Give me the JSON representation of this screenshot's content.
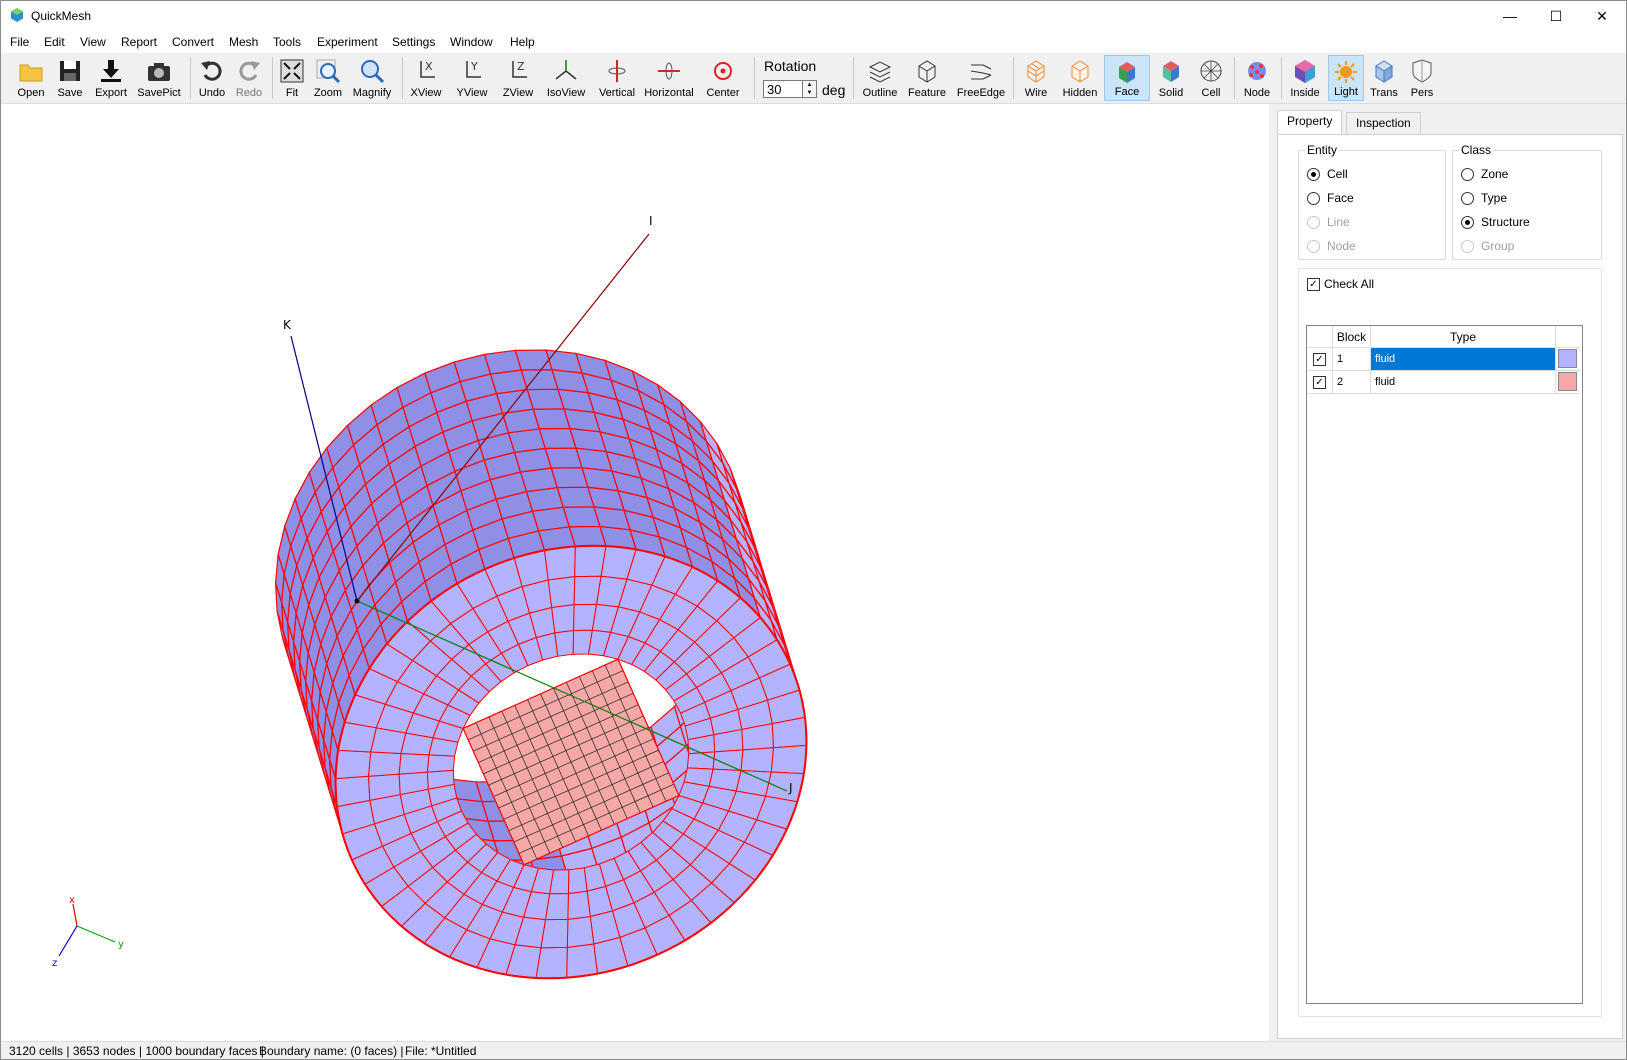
{
  "window": {
    "title": "QuickMesh",
    "minimize": "—",
    "maximize": "☐",
    "close": "✕"
  },
  "menu": [
    "File",
    "Edit",
    "View",
    "Report",
    "Convert",
    "Mesh",
    "Tools",
    "Experiment",
    "Settings",
    "Window",
    "Help"
  ],
  "toolbar": {
    "open": "Open",
    "save": "Save",
    "export": "Export",
    "savepict": "SavePict",
    "undo": "Undo",
    "redo": "Redo",
    "fit": "Fit",
    "zoom": "Zoom",
    "magnify": "Magnify",
    "xview": "XView",
    "yview": "YView",
    "zview": "ZView",
    "isoview": "IsoView",
    "vertical": "Vertical",
    "horizontal": "Horizontal",
    "center": "Center",
    "rotation_label": "Rotation",
    "rotation_value": "30",
    "rotation_unit": "deg",
    "outline": "Outline",
    "feature": "Feature",
    "freeedge": "FreeEdge",
    "wire": "Wire",
    "hidden": "Hidden",
    "face": "Face",
    "solid": "Solid",
    "cell": "Cell",
    "node": "Node",
    "inside": "Inside",
    "light": "Light",
    "trans": "Trans",
    "pers": "Pers"
  },
  "viewport": {
    "axis_labels": {
      "i": "I",
      "j": "J",
      "k": "K"
    },
    "triad": {
      "x": "x",
      "y": "y",
      "z": "z"
    },
    "colors": {
      "outer": "#b3b3ff",
      "core": "#f6a8a8",
      "edge": "#ff0000"
    }
  },
  "panel": {
    "tabs": [
      "Property",
      "Inspection"
    ],
    "entity": {
      "title": "Entity",
      "options": [
        "Cell",
        "Face",
        "Line",
        "Node"
      ],
      "selected": "Cell"
    },
    "class": {
      "title": "Class",
      "options": [
        "Zone",
        "Type",
        "Structure",
        "Group"
      ],
      "selected": "Structure"
    },
    "check_all": "Check All",
    "table": {
      "headers": [
        "Block",
        "Type"
      ],
      "rows": [
        {
          "block": "1",
          "type": "fluid",
          "color": "#b3b3ff",
          "checked": true,
          "selected": true
        },
        {
          "block": "2",
          "type": "fluid",
          "color": "#f6a8a8",
          "checked": true,
          "selected": false
        }
      ]
    }
  },
  "status": {
    "summary": "3120 cells | 3653 nodes | 1000 boundary faces |",
    "boundary": "Boundary name:  (0 faces) |",
    "file": "File: *Untitled"
  }
}
